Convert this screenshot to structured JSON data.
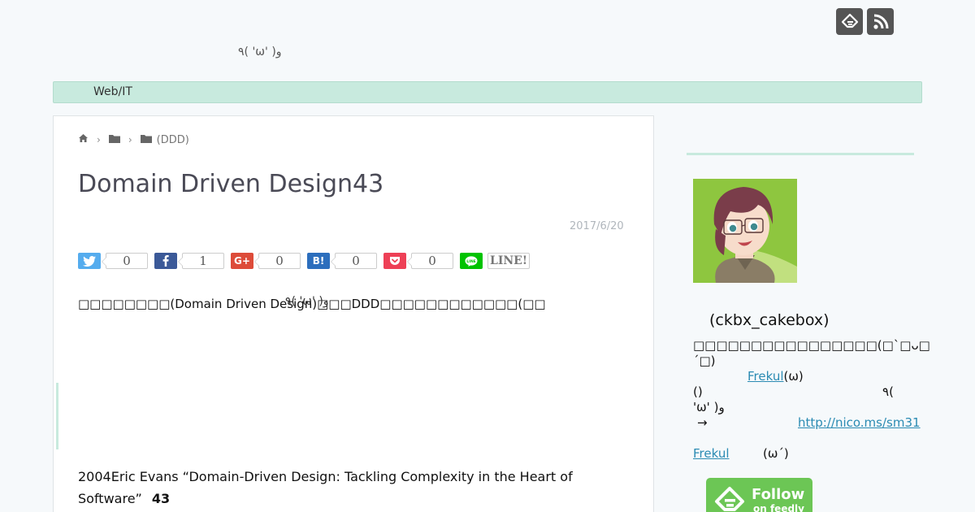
{
  "header": {
    "tagline": "٩( 'ω' )و",
    "icons": [
      "feedly-icon",
      "rss-icon"
    ]
  },
  "nav": {
    "items": [
      "Web/IT"
    ],
    "color": "#c8eade"
  },
  "breadcrumb": {
    "icons": [
      "home-icon",
      "folder-icon",
      "folder-icon"
    ],
    "last_label": "(DDD)"
  },
  "article": {
    "title": "Domain Driven Design43",
    "date": "2017/6/20",
    "intro": "□□□□□□□□(Domain Driven Design)□□□DDD□□□□□□□□□□□□(□□",
    "intro_overlay": "٩( 'ω' )و",
    "body_line": "2004Eric Evans “Domain-Driven Design: Tackling Complexity in the Heart of Software”",
    "body_strong": "43"
  },
  "share": {
    "twitter": {
      "count": "0",
      "color": "#55acee"
    },
    "facebook": {
      "count": "1",
      "color": "#3b5998"
    },
    "google": {
      "label": "G+",
      "count": "0",
      "color": "#dd4b39"
    },
    "hatena": {
      "label": "B!",
      "count": "0",
      "color": "#2c6ebd"
    },
    "pocket": {
      "count": "0",
      "color": "#ee4056"
    },
    "line": {
      "label": "LINE!",
      "color": "#00c300"
    }
  },
  "sidebar": {
    "profile_name": "(ckbx_cakebox)",
    "bio_line1": "□□□□□□□□□□□□□□□□(□`□ᴗ□´□)",
    "bio_link": "Frekul",
    "bio_after_link": "(ω)",
    "bio_line3": "()",
    "bio_line3_right": "٩(",
    "bio_line4": "'ω' )و",
    "arrow": "→",
    "url": "http://nico.ms/sm31",
    "frekul_link": "Frekul",
    "frekul_after": "(ω´)",
    "feedly_follow": "Follow",
    "feedly_sub": "on feedly"
  }
}
